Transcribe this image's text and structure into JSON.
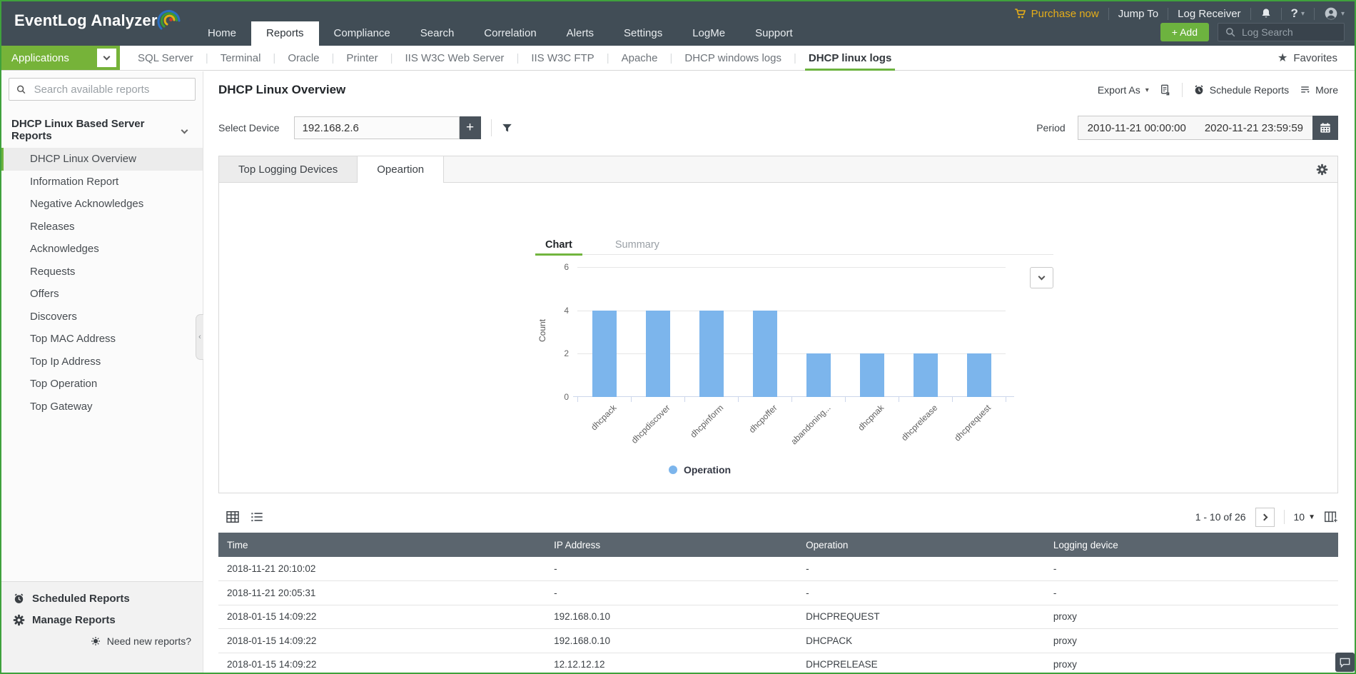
{
  "topbar": {
    "logo": "EventLog Analyzer",
    "nav": [
      "Home",
      "Reports",
      "Compliance",
      "Search",
      "Correlation",
      "Alerts",
      "Settings",
      "LogMe",
      "Support"
    ],
    "nav_active": "Reports",
    "purchase_now": "Purchase now",
    "jump_to": "Jump To",
    "log_receiver": "Log Receiver",
    "help_label": "?",
    "add_label": "+  Add",
    "log_search_label": "Log Search"
  },
  "tabstrip": {
    "applications_label": "Applications",
    "tabs": [
      "SQL Server",
      "Terminal",
      "Oracle",
      "Printer",
      "IIS W3C Web Server",
      "IIS W3C FTP",
      "Apache",
      "DHCP windows logs",
      "DHCP linux logs"
    ],
    "active_tab": "DHCP linux logs",
    "favorites_label": "Favorites"
  },
  "sidebar": {
    "search_placeholder": "Search available reports",
    "group_title": "DHCP Linux Based Server Reports",
    "items": [
      "DHCP Linux Overview",
      "Information Report",
      "Negative Acknowledges",
      "Releases",
      "Acknowledges",
      "Requests",
      "Offers",
      "Discovers",
      "Top MAC Address",
      "Top Ip Address",
      "Top Operation",
      "Top Gateway"
    ],
    "selected_item": "DHCP Linux Overview",
    "footer": {
      "scheduled": "Scheduled Reports",
      "manage": "Manage Reports",
      "need_new": "Need new reports?"
    }
  },
  "main": {
    "page_title": "DHCP Linux Overview",
    "export_as": "Export As",
    "schedule_reports": "Schedule Reports",
    "more": "More",
    "select_device_label": "Select Device",
    "device_value": "192.168.2.6",
    "plus_label": "+",
    "period_label": "Period",
    "period_from": "2010-11-21 00:00:00",
    "period_to": "2020-11-21 23:59:59",
    "panel_tabs": [
      "Top Logging Devices",
      "Opeartion"
    ],
    "panel_active_tab": "Opeartion",
    "chart_tabs": [
      "Chart",
      "Summary"
    ],
    "chart_active_tab": "Chart"
  },
  "chart_data": {
    "type": "bar",
    "categories": [
      "dhcpack",
      "dhcpdiscover",
      "dhcpinform",
      "dhcpoffer",
      "abandoning...",
      "dhcpnak",
      "dhcprelease",
      "dhcprequest"
    ],
    "values": [
      4,
      4,
      4,
      4,
      2,
      2,
      2,
      2
    ],
    "series_name": "Operation",
    "title": "",
    "xlabel": "",
    "ylabel": "Count",
    "ylim": [
      0,
      6
    ],
    "yticks": [
      0,
      2,
      4,
      6
    ],
    "grid": true,
    "legend_position": "bottom",
    "bar_color": "#7cb5ec"
  },
  "table": {
    "view_range": "1 - 10 of 26",
    "page_size": "10",
    "headers": [
      "Time",
      "IP Address",
      "Operation",
      "Logging device"
    ],
    "rows": [
      [
        "2018-11-21 20:10:02",
        "-",
        "-",
        "-"
      ],
      [
        "2018-11-21 20:05:31",
        "-",
        "-",
        "-"
      ],
      [
        "2018-01-15 14:09:22",
        "192.168.0.10",
        "DHCPREQUEST",
        "proxy"
      ],
      [
        "2018-01-15 14:09:22",
        "192.168.0.10",
        "DHCPACK",
        "proxy"
      ],
      [
        "2018-01-15 14:09:22",
        "12.12.12.12",
        "DHCPRELEASE",
        "proxy"
      ]
    ]
  },
  "colors": {
    "accent_green": "#6db33f",
    "topbar_bg": "#414d56",
    "table_header_bg": "#5b656e",
    "bar_fill": "#7cb5ec",
    "purchase_gold": "#e5ad19",
    "selected_item_bg": "#ececec",
    "page_border_green": "#3fa13c"
  }
}
